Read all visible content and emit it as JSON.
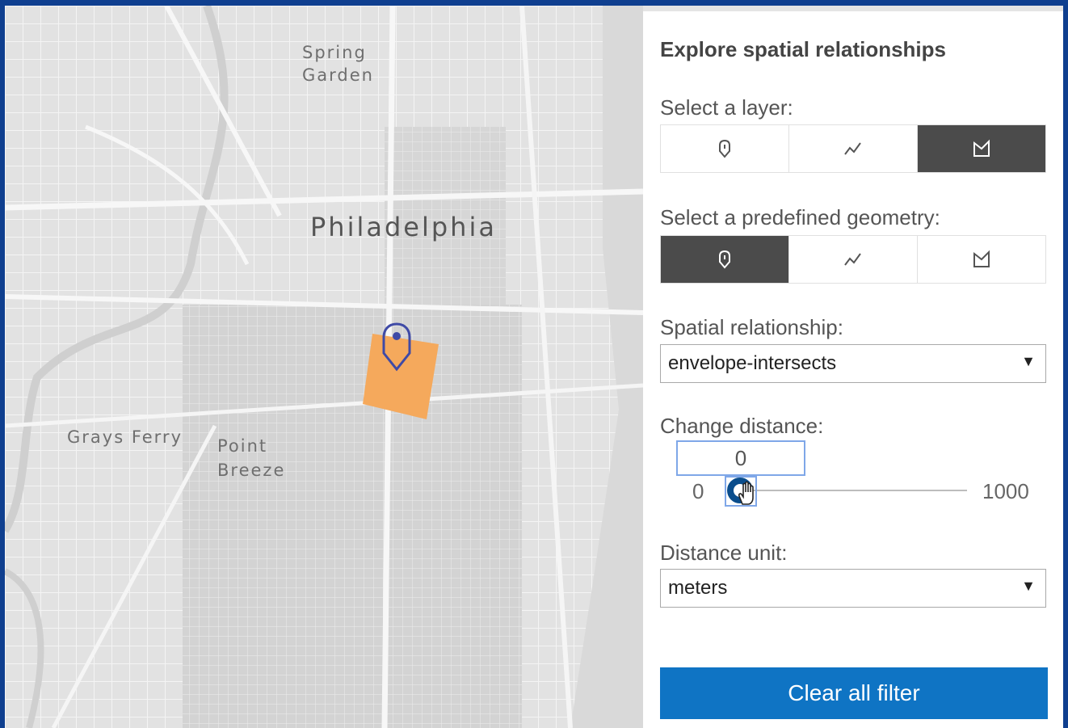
{
  "map": {
    "labels": {
      "spring_garden": "Spring\nGarden",
      "philadelphia": "Philadelphia",
      "grays_ferry": "Grays Ferry",
      "point_breeze": "Point\nBreeze"
    },
    "highlight_color": "#f5a95c",
    "marker_color": "#3f4aa6"
  },
  "panel": {
    "title": "Explore spatial relationships",
    "layer": {
      "label": "Select a layer:",
      "options": [
        "point-icon",
        "polyline-icon",
        "polygon-icon"
      ],
      "selected": "polygon-icon"
    },
    "geometry": {
      "label": "Select a predefined geometry:",
      "options": [
        "point-icon",
        "polyline-icon",
        "polygon-icon"
      ],
      "selected": "point-icon"
    },
    "relationship": {
      "label": "Spatial relationship:",
      "value": "envelope-intersects"
    },
    "distance": {
      "label": "Change distance:",
      "value": "0",
      "min": "0",
      "max": "1000",
      "level": 0
    },
    "unit": {
      "label": "Distance unit:",
      "value": "meters"
    },
    "clear_button": "Clear all filter",
    "accent": "#0f74c4",
    "active_segment": "#4b4b4b"
  }
}
